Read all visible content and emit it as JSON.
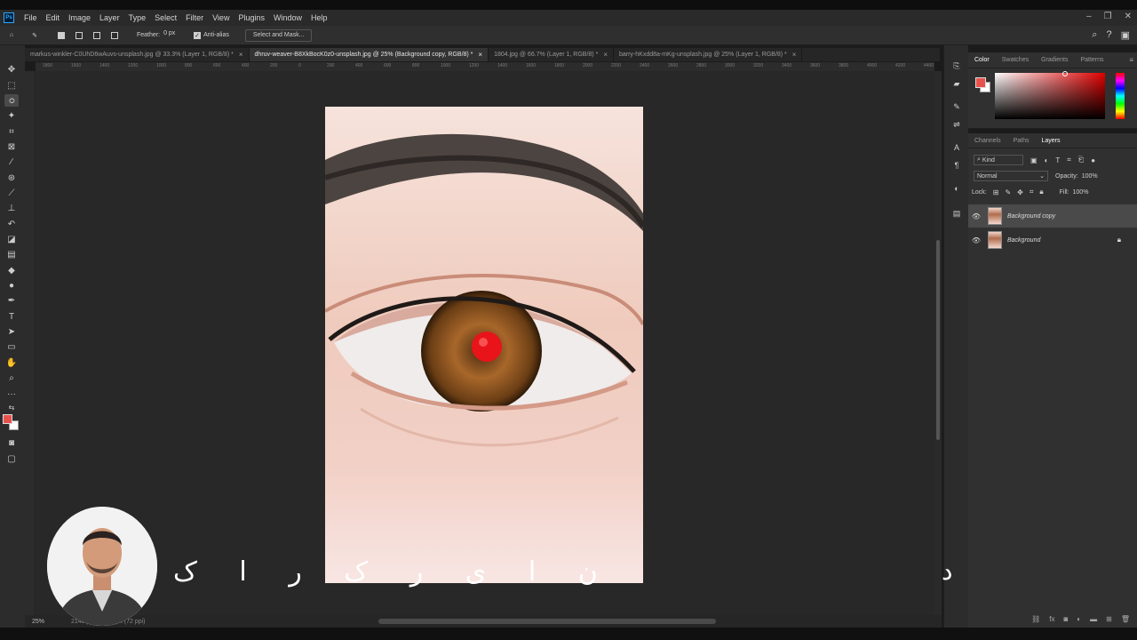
{
  "app": {
    "logo": "Ps"
  },
  "menu": [
    "File",
    "Edit",
    "Image",
    "Layer",
    "Type",
    "Select",
    "Filter",
    "View",
    "Plugins",
    "Window",
    "Help"
  ],
  "window_controls": [
    "–",
    "❐",
    "✕"
  ],
  "options": {
    "feather_label": "Feather:",
    "feather_value": "0 px",
    "anti_alias_label": "Anti-alias",
    "select_mask": "Select and Mask..."
  },
  "tabs": [
    {
      "label": "markus-winkler-C0UhD6wAuvs-unsplash.jpg @ 33.3% (Layer 1, RGB/8) *",
      "close": "×"
    },
    {
      "label": "dhruv-weaver-B8XkBocK0z0-unsplash.jpg @ 25% (Background copy, RGB/8) *",
      "close": "×"
    },
    {
      "label": "1804.jpg @ 66.7% (Layer 1, RGB/8) *",
      "close": "×"
    },
    {
      "label": "barry-hKxdd8a-mKg-unsplash.jpg @ 25% (Layer 1, RGB/8) *",
      "close": "×"
    }
  ],
  "ruler_ticks": [
    "1800",
    "1600",
    "1400",
    "1200",
    "1000",
    "800",
    "600",
    "400",
    "200",
    "0",
    "200",
    "400",
    "600",
    "800",
    "1000",
    "1200",
    "1400",
    "1600",
    "1800",
    "2000",
    "2200",
    "2400",
    "2600",
    "2800",
    "3000",
    "3200",
    "3400",
    "3600",
    "3800",
    "4000",
    "4200",
    "4400"
  ],
  "status": {
    "zoom": "25%",
    "info": "2148 px × 3222 px (72 ppi)"
  },
  "colors": {
    "foreground": "#e8524d",
    "background": "#ffffff",
    "pupil": "#e8141a"
  },
  "color_panel": {
    "tabs": [
      "Color",
      "Swatches",
      "Gradients",
      "Patterns"
    ],
    "menu": "≡"
  },
  "layers_panel": {
    "tabs": [
      "Channels",
      "Paths",
      "Layers"
    ],
    "filter_kind": "Kind",
    "blend_mode": "Normal",
    "opacity_label": "Opacity:",
    "opacity_value": "100%",
    "lock_label": "Lock:",
    "fill_label": "Fill:",
    "fill_value": "100%",
    "layers": [
      {
        "name": "Background copy",
        "visible": true,
        "selected": true
      },
      {
        "name": "Background",
        "visible": true,
        "selected": false,
        "locked": true
      }
    ]
  },
  "overlay_text": {
    "caption": [
      "ن",
      "ا",
      "ی",
      "ر",
      "ک",
      "ر",
      "ا",
      "ک"
    ],
    "caption_end": "د"
  }
}
